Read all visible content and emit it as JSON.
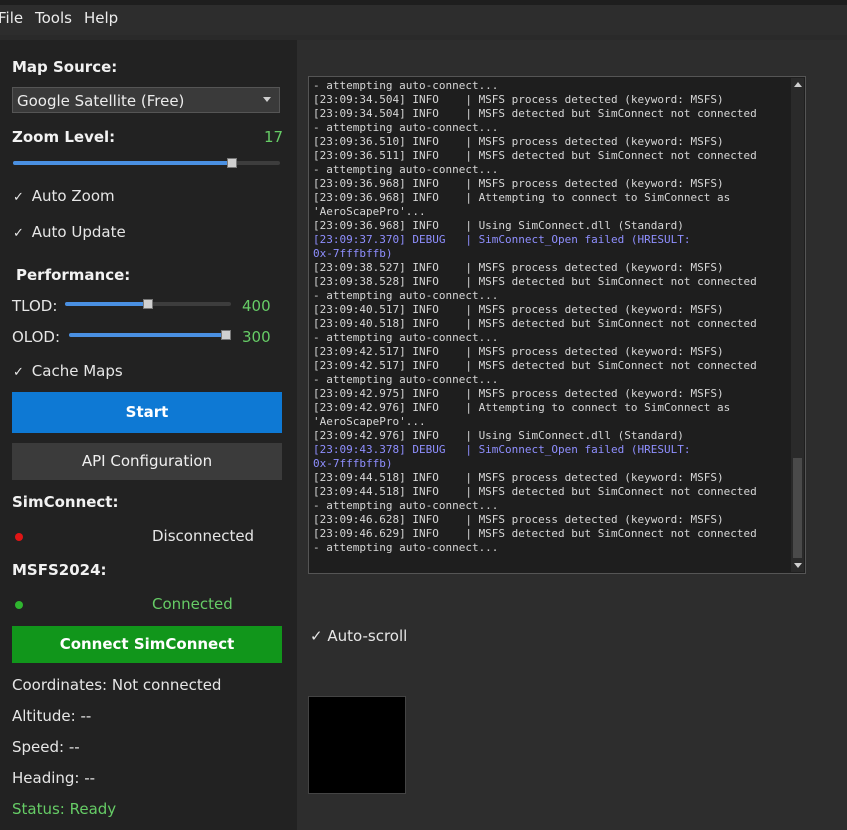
{
  "menu": [
    "File",
    "Tools",
    "Help"
  ],
  "left": {
    "map_source_label": "Map Source:",
    "map_source_value": "Google Satellite (Free)",
    "zoom_label": "Zoom Level:",
    "zoom_value": "17",
    "zoom_fraction": 0.82,
    "auto_zoom": "Auto Zoom",
    "auto_update": "Auto Update",
    "performance_label": "Performance:",
    "tlod_label": "TLOD:",
    "tlod_value": "400",
    "tlod_fraction": 0.5,
    "olod_label": "OLOD:",
    "olod_value": "300",
    "olod_fraction": 1.0,
    "cache_maps": "Cache Maps",
    "start_button": "Start",
    "api_button": "API Configuration",
    "simconnect_label": "SimConnect:",
    "simconnect_status": "Disconnected",
    "msfs_label": "MSFS2024:",
    "msfs_status": "Connected",
    "connect_button": "Connect SimConnect",
    "coordinates": "Coordinates: Not connected",
    "altitude": "Altitude: --",
    "speed": "Speed: --",
    "heading": "Heading: --",
    "status": "Status: Ready"
  },
  "colors": {
    "accent_blue": "#0e79d4",
    "connect_green": "#11961b",
    "status_green": "#66cc66",
    "disconnected_red": "#e01515",
    "debug_text": "#8f8fff"
  },
  "log": [
    {
      "text": "- attempting auto-connect...",
      "level": "info"
    },
    {
      "text": "[23:09:34.504] INFO    | MSFS process detected (keyword: MSFS)",
      "level": "info"
    },
    {
      "text": "[23:09:34.504] INFO    | MSFS detected but SimConnect not connected",
      "level": "info"
    },
    {
      "text": "- attempting auto-connect...",
      "level": "info"
    },
    {
      "text": "[23:09:36.510] INFO    | MSFS process detected (keyword: MSFS)",
      "level": "info"
    },
    {
      "text": "[23:09:36.511] INFO    | MSFS detected but SimConnect not connected",
      "level": "info"
    },
    {
      "text": "- attempting auto-connect...",
      "level": "info"
    },
    {
      "text": "[23:09:36.968] INFO    | MSFS process detected (keyword: MSFS)",
      "level": "info"
    },
    {
      "text": "[23:09:36.968] INFO    | Attempting to connect to SimConnect as",
      "level": "info"
    },
    {
      "text": "'AeroScapePro'...",
      "level": "info"
    },
    {
      "text": "[23:09:36.968] INFO    | Using SimConnect.dll (Standard)",
      "level": "info"
    },
    {
      "text": "[23:09:37.370] DEBUG   | SimConnect_Open failed (HRESULT:",
      "level": "debug"
    },
    {
      "text": "0x-7fffbffb)",
      "level": "debug"
    },
    {
      "text": "[23:09:38.527] INFO    | MSFS process detected (keyword: MSFS)",
      "level": "info"
    },
    {
      "text": "[23:09:38.528] INFO    | MSFS detected but SimConnect not connected",
      "level": "info"
    },
    {
      "text": "- attempting auto-connect...",
      "level": "info"
    },
    {
      "text": "[23:09:40.517] INFO    | MSFS process detected (keyword: MSFS)",
      "level": "info"
    },
    {
      "text": "[23:09:40.518] INFO    | MSFS detected but SimConnect not connected",
      "level": "info"
    },
    {
      "text": "- attempting auto-connect...",
      "level": "info"
    },
    {
      "text": "[23:09:42.517] INFO    | MSFS process detected (keyword: MSFS)",
      "level": "info"
    },
    {
      "text": "[23:09:42.517] INFO    | MSFS detected but SimConnect not connected",
      "level": "info"
    },
    {
      "text": "- attempting auto-connect...",
      "level": "info"
    },
    {
      "text": "[23:09:42.975] INFO    | MSFS process detected (keyword: MSFS)",
      "level": "info"
    },
    {
      "text": "[23:09:42.976] INFO    | Attempting to connect to SimConnect as",
      "level": "info"
    },
    {
      "text": "'AeroScapePro'...",
      "level": "info"
    },
    {
      "text": "[23:09:42.976] INFO    | Using SimConnect.dll (Standard)",
      "level": "info"
    },
    {
      "text": "[23:09:43.378] DEBUG   | SimConnect_Open failed (HRESULT:",
      "level": "debug"
    },
    {
      "text": "0x-7fffbffb)",
      "level": "debug"
    },
    {
      "text": "[23:09:44.518] INFO    | MSFS process detected (keyword: MSFS)",
      "level": "info"
    },
    {
      "text": "[23:09:44.518] INFO    | MSFS detected but SimConnect not connected",
      "level": "info"
    },
    {
      "text": "- attempting auto-connect...",
      "level": "info"
    },
    {
      "text": "[23:09:46.628] INFO    | MSFS process detected (keyword: MSFS)",
      "level": "info"
    },
    {
      "text": "[23:09:46.629] INFO    | MSFS detected but SimConnect not connected",
      "level": "info"
    },
    {
      "text": "- attempting auto-connect...",
      "level": "info"
    }
  ],
  "right": {
    "auto_scroll": "Auto-scroll"
  }
}
